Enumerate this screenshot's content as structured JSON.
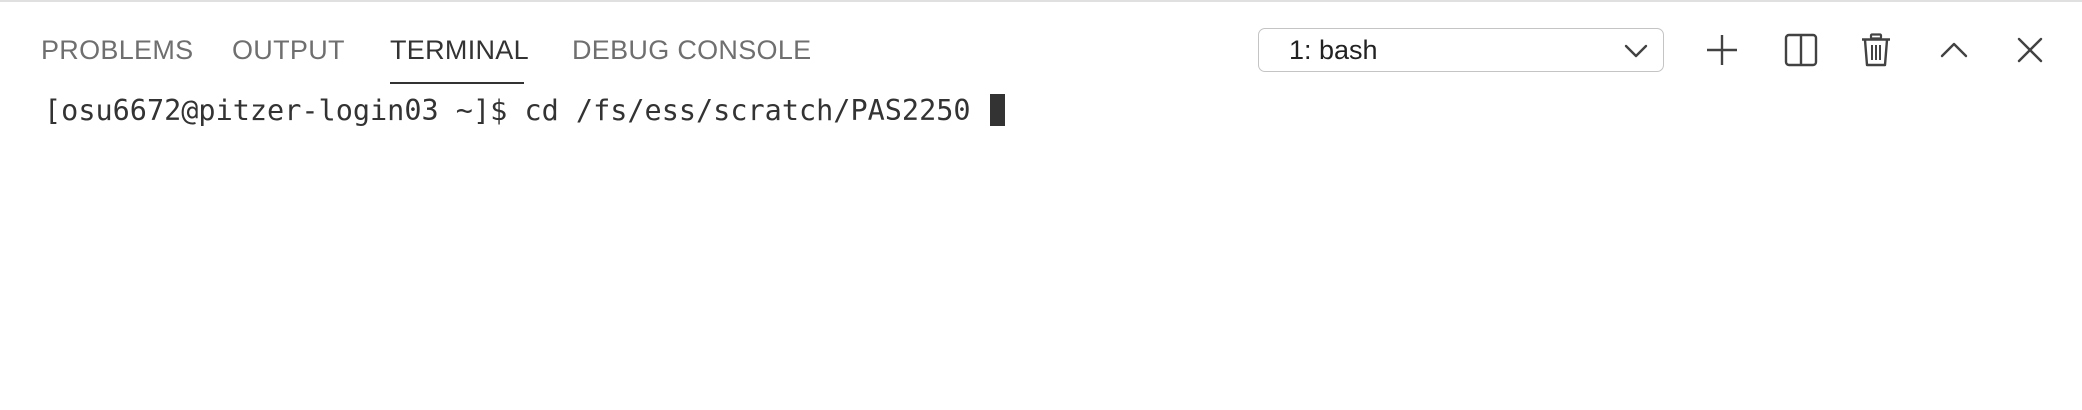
{
  "tabs": [
    {
      "label": "PROBLEMS",
      "active": false
    },
    {
      "label": "OUTPUT",
      "active": false
    },
    {
      "label": "TERMINAL",
      "active": true
    },
    {
      "label": "DEBUG CONSOLE",
      "active": false
    }
  ],
  "terminal_select": {
    "selected": "1: bash"
  },
  "toolbar": {
    "icons": [
      "plus-icon",
      "split-icon",
      "trash-icon",
      "chevron-up-icon",
      "close-icon"
    ]
  },
  "terminal": {
    "prompt": "[osu6672@pitzer-login03 ~]$ ",
    "command": "cd /fs/ess/scratch/PAS2250 "
  },
  "colors": {
    "background": "#ffffff",
    "active_tab": "#333333",
    "inactive_tab": "#6f6f6f",
    "icon": "#424242"
  }
}
